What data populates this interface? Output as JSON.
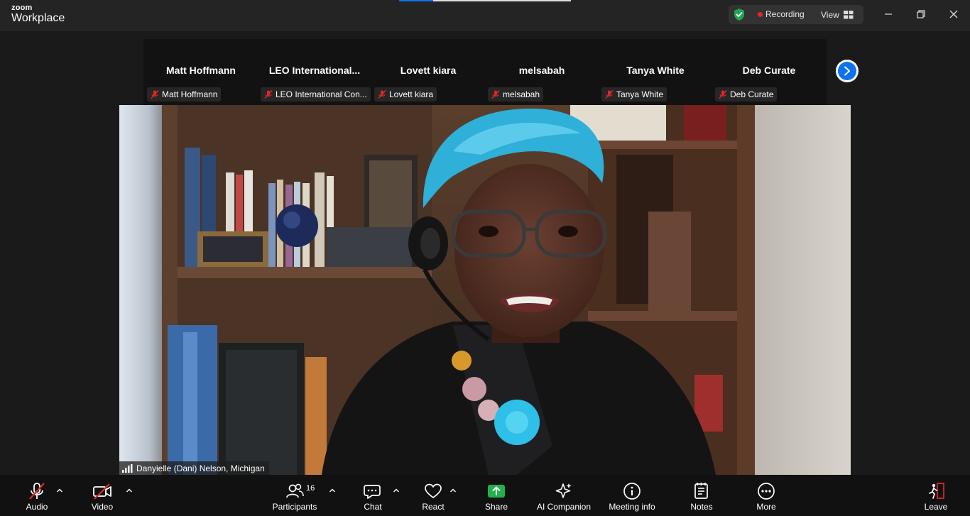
{
  "app": {
    "brand_top": "zoom",
    "brand_bottom": "Workplace"
  },
  "status": {
    "recording_label": "Recording",
    "view_label": "View"
  },
  "gallery": {
    "participants": [
      {
        "display_name": "Matt Hoffmann",
        "tag_name": "Matt Hoffmann"
      },
      {
        "display_name": "LEO  International...",
        "tag_name": "LEO International Con..."
      },
      {
        "display_name": "Lovett kiara",
        "tag_name": "Lovett kiara"
      },
      {
        "display_name": "melsabah",
        "tag_name": "melsabah"
      },
      {
        "display_name": "Tanya White",
        "tag_name": "Tanya White"
      },
      {
        "display_name": "Deb Curate",
        "tag_name": "Deb Curate"
      }
    ]
  },
  "speaker": {
    "name": "Danyielle (Dani) Nelson,  Michigan"
  },
  "toolbar": {
    "audio": "Audio",
    "video": "Video",
    "participants": "Participants",
    "participants_count": "16",
    "chat": "Chat",
    "react": "React",
    "share": "Share",
    "ai_companion": "AI Companion",
    "meeting_info": "Meeting info",
    "notes": "Notes",
    "more": "More",
    "leave": "Leave"
  },
  "colors": {
    "accent_blue": "#0e72ed",
    "recording_red": "#e02828",
    "share_green": "#22b14c",
    "muted_red": "#e02828",
    "shield_green": "#23a455"
  }
}
